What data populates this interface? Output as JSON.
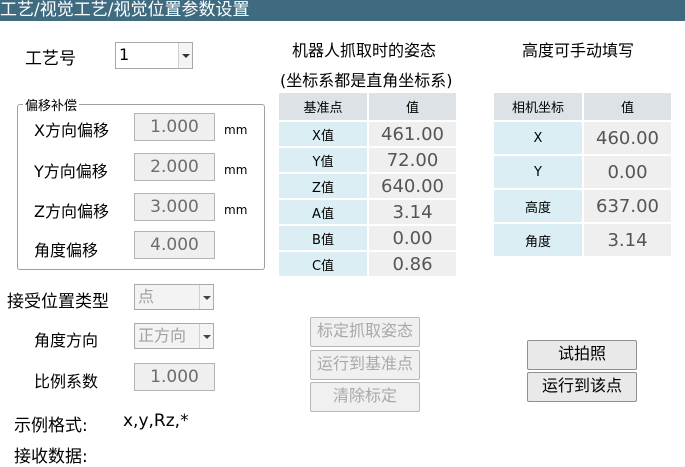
{
  "window": {
    "title": "工艺/视觉工艺/视觉位置参数设置"
  },
  "process": {
    "label": "工艺号",
    "value": "1"
  },
  "offset_group": {
    "title": "偏移补偿",
    "rows": [
      {
        "label": "X方向偏移",
        "value": "1.000",
        "unit": "mm"
      },
      {
        "label": "Y方向偏移",
        "value": "2.000",
        "unit": "mm"
      },
      {
        "label": "Z方向偏移",
        "value": "3.000",
        "unit": "mm"
      },
      {
        "label": "角度偏移",
        "value": "4.000",
        "unit": ""
      }
    ]
  },
  "accept": {
    "type_label": "接受位置类型",
    "type_value": "点",
    "angle_label": "角度方向",
    "angle_value": "正方向",
    "ratio_label": "比例系数",
    "ratio_value": "1.000"
  },
  "example": {
    "label": "示例格式:",
    "value": "x,y,Rz,*"
  },
  "receive": {
    "label": "接收数据:"
  },
  "robot_pose": {
    "title_line1": "机器人抓取时的姿态",
    "title_line2": "(坐标系都是直角坐标系)",
    "columns": [
      "基准点",
      "值"
    ],
    "rows": [
      {
        "key": "X值",
        "value": "461.00"
      },
      {
        "key": "Y值",
        "value": "72.00"
      },
      {
        "key": "Z值",
        "value": "640.00"
      },
      {
        "key": "A值",
        "value": "3.14"
      },
      {
        "key": "B值",
        "value": "0.00"
      },
      {
        "key": "C值",
        "value": "0.86"
      }
    ]
  },
  "camera": {
    "title": "高度可手动填写",
    "columns": [
      "相机坐标",
      "值"
    ],
    "rows": [
      {
        "key": "X",
        "value": "460.00"
      },
      {
        "key": "Y",
        "value": "0.00"
      },
      {
        "key": "高度",
        "value": "637.00"
      },
      {
        "key": "角度",
        "value": "3.14"
      }
    ]
  },
  "buttons": {
    "calibrate": "标定抓取姿态",
    "run_to_base": "运行到基准点",
    "clear_calib": "清除标定",
    "test_shot": "试拍照",
    "run_to_point": "运行到该点"
  }
}
